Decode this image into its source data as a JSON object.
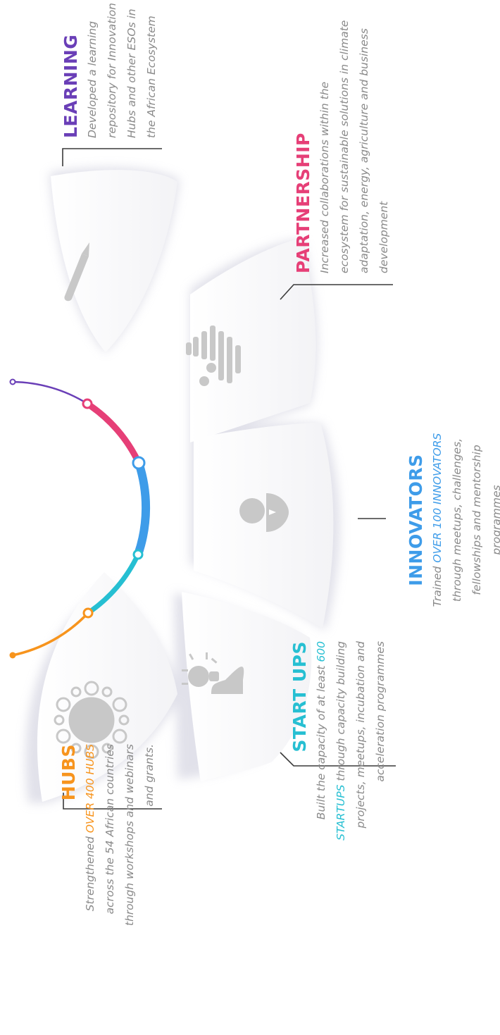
{
  "colors": {
    "hubs": "#f7941d",
    "startups": "#26bfd2",
    "innovators": "#3e9ce9",
    "partnership": "#e63f77",
    "learning": "#6a3fb7",
    "text": "#8a8a8a",
    "panel": "#f5f5f7",
    "icon": "#c8c8c8"
  },
  "sections": {
    "hubs": {
      "title": "HUBS",
      "text_before": "Strengthened ",
      "highlight": "OVER 400 HUBS",
      "text_after": " across the 54 African countries through workshops and webinars and grants.",
      "icon": "hub-network-icon"
    },
    "startups": {
      "title": "START UPS",
      "text_before": "Built the capacity of at least ",
      "highlight": "600 STARTUPS",
      "text_after": " through capacity building projects, meetups, incubation and acceleration programmes",
      "icon": "lightbulb-idea-icon"
    },
    "innovators": {
      "title": "INNOVATORS",
      "text_before": "Trained ",
      "highlight": "OVER 100 INNOVATORS",
      "text_after": " through meetups, challenges, fellowships and mentorship programmes",
      "icon": "person-icon"
    },
    "partnership": {
      "title": "PARTNERSHIP",
      "text": "Increased collaborations within the ecosystem for sustainable solutions in climate adaptation, energy, agriculture and business development",
      "icon": "people-group-icon"
    },
    "learning": {
      "title": "LEARNING",
      "text": "Developed a learning repository for Innovation Hubs and other ESOs in the African Ecosystem",
      "icon": "pencil-icon"
    }
  }
}
